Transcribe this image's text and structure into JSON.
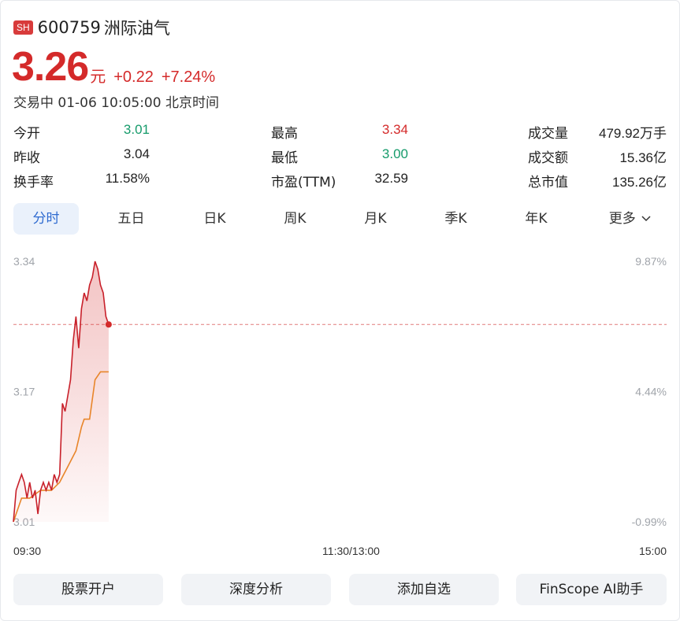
{
  "stock": {
    "market": "SH",
    "code": "600759",
    "name": "洲际油气",
    "price": "3.26",
    "unit": "元",
    "change": "+0.22",
    "change_pct": "+7.24%",
    "status": "交易中 01-06 10:05:00 北京时间"
  },
  "stats": {
    "open_label": "今开",
    "open": "3.01",
    "prev_label": "昨收",
    "prev": "3.04",
    "turnover_label": "换手率",
    "turnover": "11.58%",
    "high_label": "最高",
    "high": "3.34",
    "low_label": "最低",
    "low": "3.00",
    "pe_label": "市盈(TTM)",
    "pe": "32.59",
    "volume_label": "成交量",
    "volume": "479.92万手",
    "amount_label": "成交额",
    "amount": "15.36亿",
    "mktcap_label": "总市值",
    "mktcap": "135.26亿"
  },
  "tabs": [
    "分时",
    "五日",
    "日K",
    "周K",
    "月K",
    "季K",
    "年K",
    "更多"
  ],
  "active_tab": 0,
  "buttons": [
    "股票开户",
    "深度分析",
    "添加自选",
    "FinScope AI助手"
  ],
  "colors": {
    "up": "#d42a2a",
    "down": "#169b6b",
    "avg_line": "#e8852a",
    "accent": "#2f6bd0"
  },
  "chart_data": {
    "type": "line",
    "x_ticks": [
      "09:30",
      "11:30/13:00",
      "15:00"
    ],
    "y_ticks_left": [
      "3.34",
      "3.17",
      "3.01"
    ],
    "y_ticks_right": [
      "9.87%",
      "4.44%",
      "-0.99%"
    ],
    "ylim": [
      3.01,
      3.34
    ],
    "prev_close": 3.26,
    "total_minutes": 240,
    "series": [
      {
        "role": "price",
        "x": [
          0,
          1,
          2,
          3,
          4,
          5,
          6,
          7,
          8,
          9,
          10,
          11,
          12,
          13,
          14,
          15,
          16,
          17,
          18,
          19,
          20,
          21,
          22,
          23,
          24,
          25,
          26,
          27,
          28,
          29,
          30,
          31,
          32,
          33,
          34,
          35
        ],
        "y": [
          3.01,
          3.05,
          3.06,
          3.07,
          3.06,
          3.04,
          3.06,
          3.04,
          3.05,
          3.02,
          3.05,
          3.06,
          3.05,
          3.06,
          3.05,
          3.07,
          3.06,
          3.07,
          3.16,
          3.15,
          3.17,
          3.19,
          3.24,
          3.27,
          3.23,
          3.28,
          3.3,
          3.29,
          3.31,
          3.32,
          3.34,
          3.33,
          3.31,
          3.3,
          3.27,
          3.26
        ]
      },
      {
        "role": "average",
        "x": [
          0,
          3,
          6,
          10,
          14,
          17,
          20,
          23,
          25,
          26,
          28,
          30,
          32,
          35
        ],
        "y": [
          3.01,
          3.04,
          3.04,
          3.05,
          3.05,
          3.06,
          3.08,
          3.1,
          3.13,
          3.14,
          3.14,
          3.19,
          3.2,
          3.2
        ]
      }
    ]
  }
}
